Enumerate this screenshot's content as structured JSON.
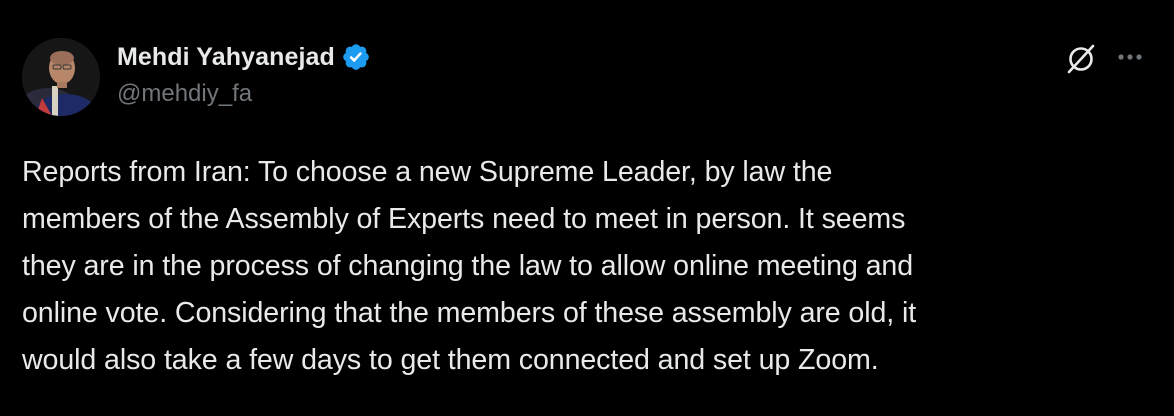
{
  "author": {
    "display_name": "Mehdi Yahyanejad",
    "handle": "@mehdiy_fa",
    "verified": true
  },
  "tweet": {
    "text": "Reports from Iran: To choose a new Supreme Leader, by law the\nmembers of the Assembly of Experts need to meet in person. It seems\nthey are in the process of changing the law to allow online meeting and\nonline vote. Considering that the members of these assembly are old, it\nwould also take a few days to get them connected and set up Zoom."
  },
  "icons": {
    "verified": "verified-badge-icon",
    "grok": "grok-icon",
    "more": "more-options-icon"
  },
  "colors": {
    "background": "#000000",
    "text_primary": "#e7e9ea",
    "text_secondary": "#71767b",
    "verified_blue": "#1d9bf0"
  }
}
